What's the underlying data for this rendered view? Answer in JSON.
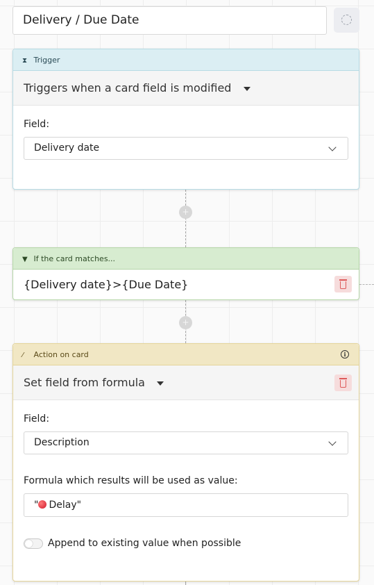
{
  "header": {
    "title": "Delivery / Due Date",
    "status_icon": "spinner-icon"
  },
  "trigger": {
    "label": "Trigger",
    "icon": "hourglass-icon",
    "type": "Triggers when a card field is modified",
    "field_label": "Field:",
    "field_value": "Delivery date"
  },
  "condition": {
    "label": "If the card matches...",
    "icon": "filter-icon",
    "expression": "{Delivery date}>{Due Date}"
  },
  "action": {
    "label": "Action on card",
    "icon": "magic-wand-icon",
    "type": "Set field from formula",
    "field_label": "Field:",
    "field_value": "Description",
    "formula_label": "Formula which results will be used as value:",
    "formula_prefix": "\"",
    "formula_text": "Delay\"",
    "append_label": "Append to existing value when possible",
    "append_enabled": false
  },
  "colors": {
    "trigger_header": "#dbeef3",
    "condition_header": "#d7ecd0",
    "action_header": "#f1e7c4",
    "delete_icon": "#de5a5a"
  }
}
